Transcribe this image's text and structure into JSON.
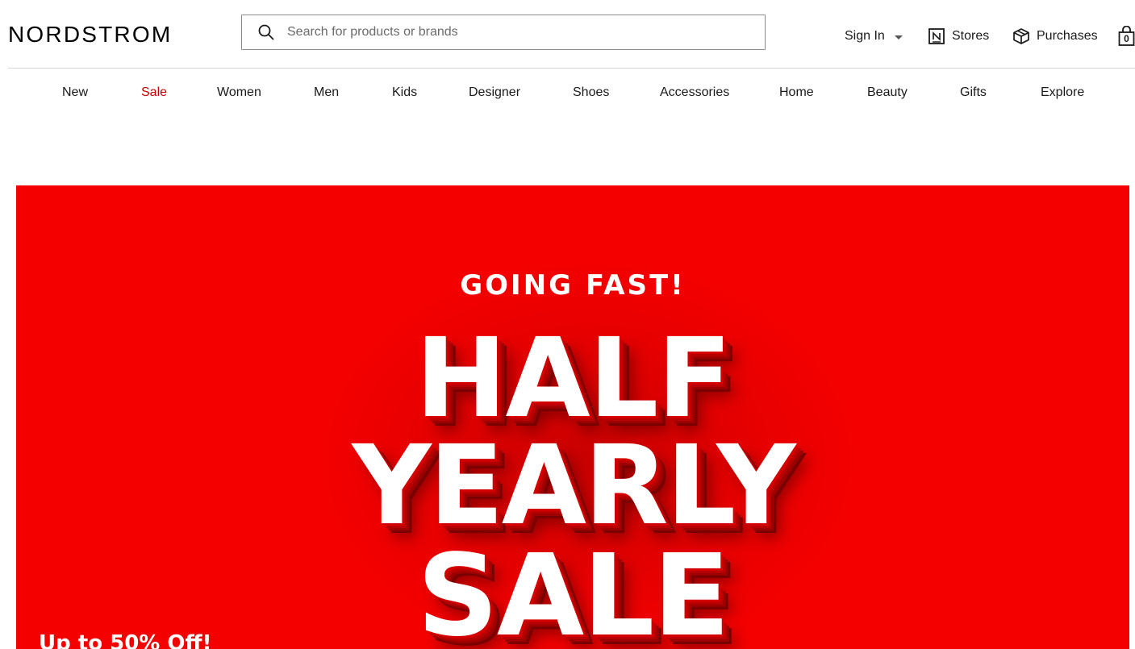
{
  "header": {
    "logo": "NORDSTROM",
    "search": {
      "placeholder": "Search for products or brands",
      "value": ""
    },
    "signin_label": "Sign In",
    "stores_label": "Stores",
    "purchases_label": "Purchases",
    "bag_count": "0"
  },
  "nav": {
    "items": [
      {
        "label": "New"
      },
      {
        "label": "Sale"
      },
      {
        "label": "Women"
      },
      {
        "label": "Men"
      },
      {
        "label": "Kids"
      },
      {
        "label": "Designer"
      },
      {
        "label": "Shoes"
      },
      {
        "label": "Accessories"
      },
      {
        "label": "Home"
      },
      {
        "label": "Beauty"
      },
      {
        "label": "Gifts"
      },
      {
        "label": "Explore"
      }
    ],
    "highlight_color": "#c80000"
  },
  "hero": {
    "eyebrow": "GOING FAST!",
    "line1": "HALF",
    "line2": "YEARLY",
    "line3": "SALE",
    "promo": "Up to 50% Off!",
    "background_color": "#f50000",
    "text_color": "#ffffff"
  }
}
